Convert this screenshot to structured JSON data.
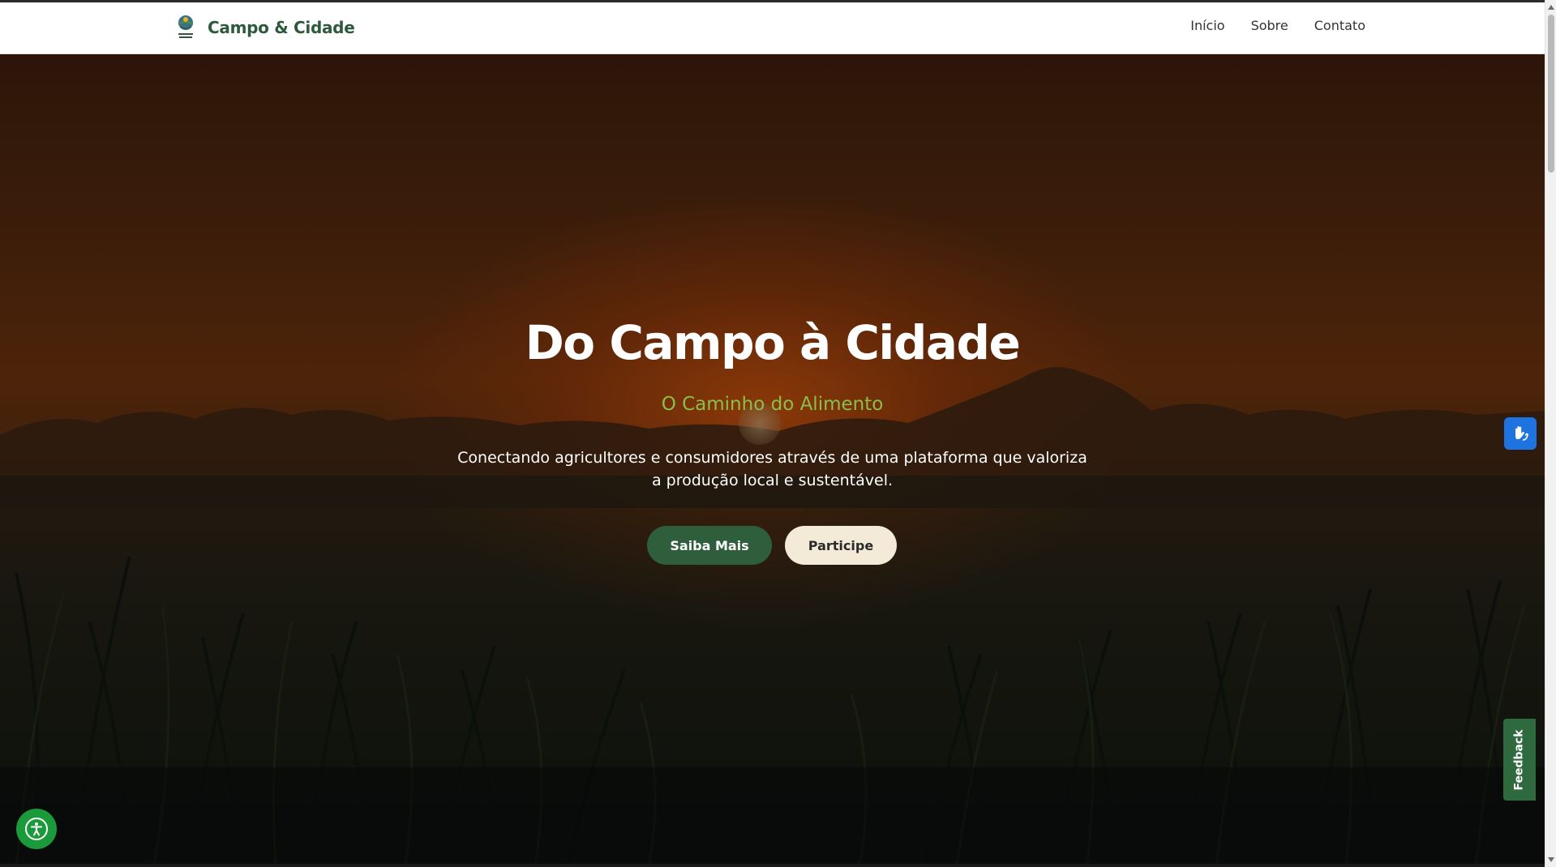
{
  "header": {
    "brand_name": "Campo & Cidade",
    "logo_icon": "campo-cidade-logo",
    "nav": [
      {
        "label": "Início"
      },
      {
        "label": "Sobre"
      },
      {
        "label": "Contato"
      }
    ]
  },
  "hero": {
    "title": "Do Campo à Cidade",
    "subtitle": "O Caminho do Alimento",
    "description": "Conectando agricultores e consumidores através de uma plataforma que valoriza a produção local e sustentável.",
    "primary_button": "Saiba Mais",
    "secondary_button": "Participe"
  },
  "widgets": {
    "vlibras_icon": "sign-language-hands-icon",
    "feedback_label": "Feedback",
    "accessibility_icon": "accessibility-person-icon"
  },
  "colors": {
    "brand_green": "#2e5a3c",
    "subtitle_green": "#8bbf4a",
    "primary_button": "#2f5e3d",
    "secondary_button": "#f3ead8",
    "vlibras_blue": "#1f73e0",
    "a11y_green": "#1a9a3a"
  }
}
